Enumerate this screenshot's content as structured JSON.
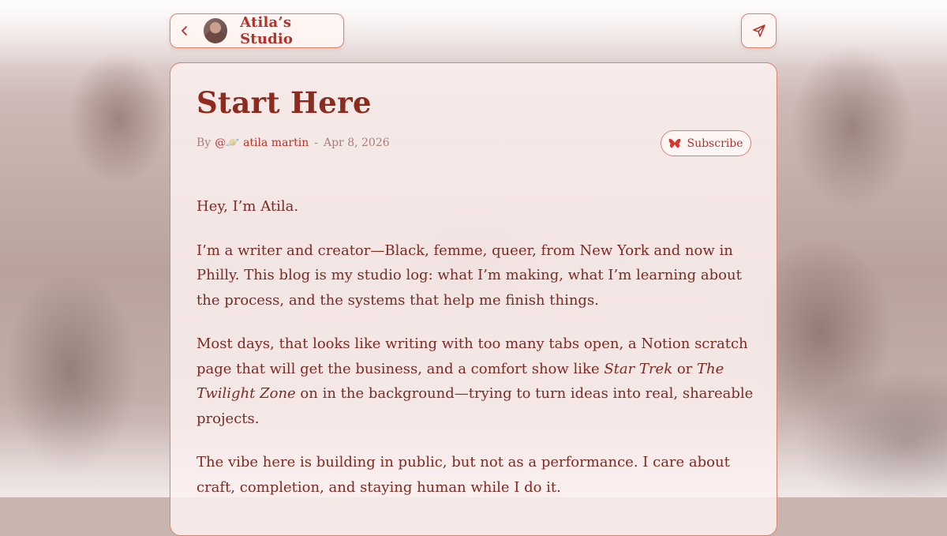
{
  "header": {
    "back_icon": "chevron-left-icon",
    "studio_name": "Atila’s Studio",
    "share_icon": "send-icon"
  },
  "post": {
    "title": "Start Here",
    "by_label": "By",
    "author": "@🪐 atila martin",
    "date": "Apr 8, 2026",
    "subscribe_label": "Subscribe",
    "subscribe_icon": "butterfly-icon",
    "paragraphs": {
      "p1": "Hey, I’m Atila.",
      "p2": "I’m a writer and creator—Black, femme, queer, from New York and now in Philly. This blog is my studio log: what I’m making, what I’m learning about the process, and the systems that help me finish things.",
      "p3_a": "Most days, that looks like writing with too many tabs open, a Notion scratch page that will get the business, and a comfort show like ",
      "p3_em1": "Star Trek",
      "p3_b": " or ",
      "p3_em2": "The Twilight Zone",
      "p3_c": " on in the background—trying to turn ideas into real, shareable projects.",
      "p4": "The vibe here is building in public, but not as a performance. I care about craft, completion, and staying human while I do it."
    }
  },
  "colors": {
    "accent": "#b5322a",
    "title": "#8e2b1e",
    "border": "#d9826a",
    "body_text": "#7e2a22"
  }
}
